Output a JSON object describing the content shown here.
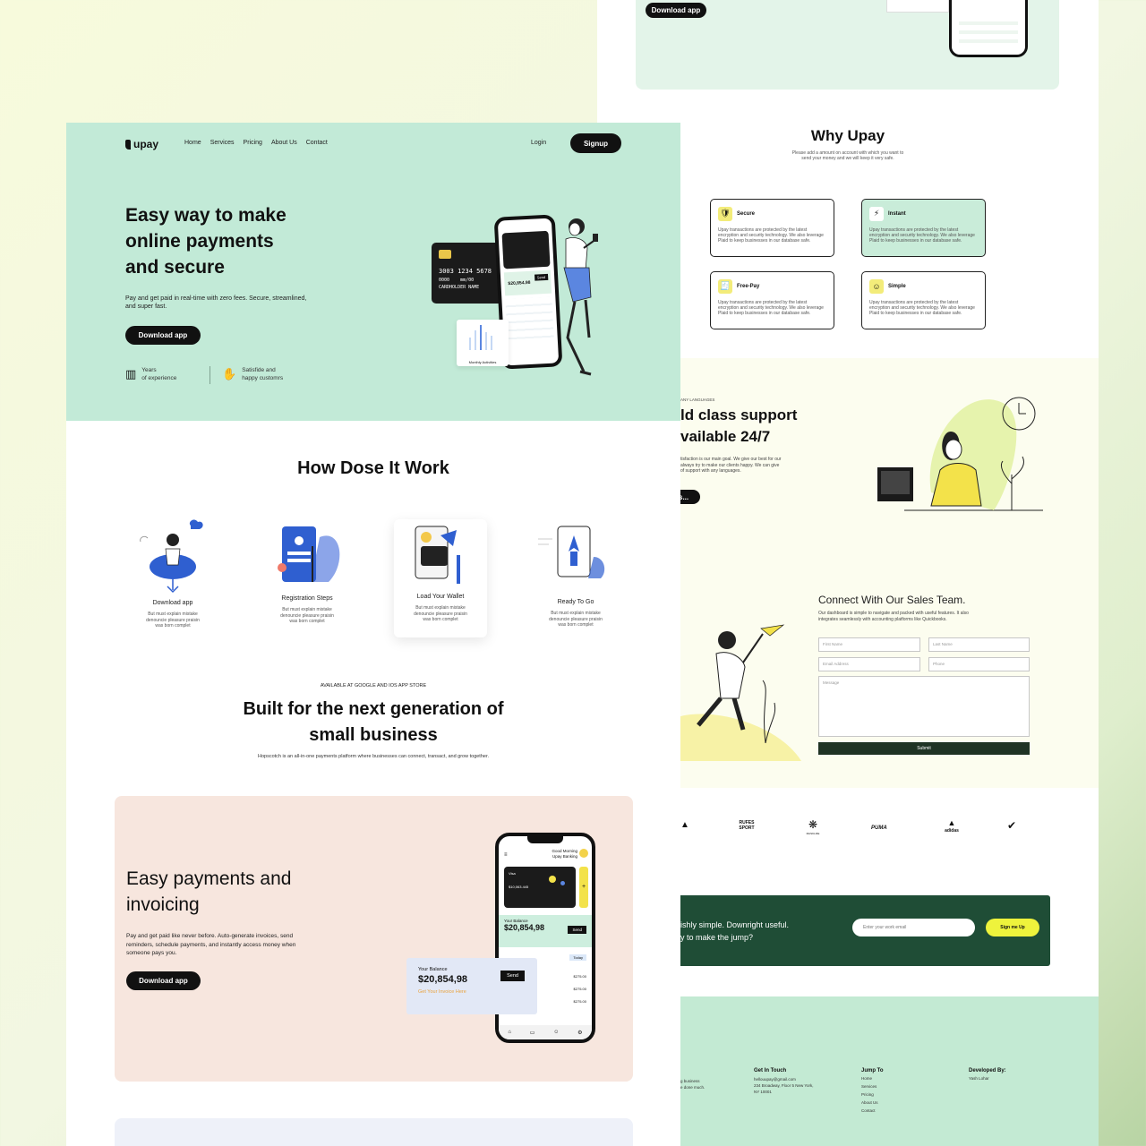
{
  "top_strip": {
    "download_label": "Download app"
  },
  "why": {
    "title": "Why Upay",
    "subtitle_line1": "Please add a amount on account with which you want to",
    "subtitle_line2": "send your money and we will keep it very safe.",
    "features": [
      {
        "icon": "shield-icon",
        "glyph": "🛡",
        "title": "Secure",
        "desc": "Upay transactions are protected by the latest encryption and security technology. We also leverage Plaid to keep businesses in our database safe."
      },
      {
        "icon": "lightning-icon",
        "glyph": "⚡",
        "title": "Instant",
        "desc": "Upay transactions are protected by the latest encryption and security technology. We also leverage Plaid to keep businesses in our database safe."
      },
      {
        "icon": "receipt-icon",
        "glyph": "🧾",
        "title": "Free-Pay",
        "desc": "Upay transactions are protected by the latest encryption and security technology. We also leverage Plaid to keep businesses in our database safe."
      },
      {
        "icon": "smile-icon",
        "glyph": "☺",
        "title": "Simple",
        "desc": "Upay transactions are protected by the latest encryption and security technology. We also leverage Plaid to keep businesses in our database safe."
      }
    ]
  },
  "support": {
    "eyebrow": "ANY LANGUAGES",
    "title_line1": "ld class support",
    "title_line2": "vailable 24/7",
    "desc_line1": "tisfaction is our main goal. We give our best for our",
    "desc_line2": "always try to make our clients happy. We can give",
    "desc_line3": "of support with any languages.",
    "button_label": "s..."
  },
  "contact": {
    "title": "Connect With Our Sales Team.",
    "desc_line1": "Our dashboard is simple to navigate and packed with useful features. It also",
    "desc_line2": "integrates seamlessly with accounting platforms like Quickbooks.",
    "first_name": "First Name",
    "last_name": "Last Name",
    "email": "Email Address",
    "phone": "Phone",
    "message": "Message",
    "submit_label": "Submit"
  },
  "brands": [
    {
      "name": "",
      "glyph": "▲"
    },
    {
      "name": "RUFES SPORT",
      "glyph": ""
    },
    {
      "name": "MASKLIFE",
      "glyph": "❋"
    },
    {
      "name": "PUMA",
      "glyph": ""
    },
    {
      "name": "adidas",
      "glyph": "▲"
    },
    {
      "name": "",
      "glyph": "✔"
    }
  ],
  "newsletter": {
    "line1": "ishly simple. Downright useful.",
    "line2": "y to make the jump?",
    "email_placeholder": "Enter your work email",
    "signup_label": "Sign me Up"
  },
  "footer": {
    "about_line1": "g business",
    "about_line2": "e done much.",
    "contact_title": "Get In Touch",
    "contact_email": "hellouupay@gmail.com",
    "contact_addr1": "234 Broadway, Floor 5 New York,",
    "contact_addr2": "NY 10001",
    "jump_title": "Jump To",
    "jump_links": [
      "Home",
      "Services",
      "Pricing",
      "About Us",
      "Contact"
    ],
    "dev_title": "Developed By:",
    "dev_name": "Yash Lohar"
  },
  "nav": {
    "logo": "upay",
    "links": [
      "Home",
      "Services",
      "Pricing",
      "About Us",
      "Contact"
    ],
    "login": "Login",
    "signup": "Signup"
  },
  "hero": {
    "title_line1": "Easy way to make",
    "title_line2": "online payments",
    "title_line3": "and secure",
    "desc_line1": "Pay and get paid in real-time with zero fees. Secure, streamlined,",
    "desc_line2": "and super fast.",
    "download_label": "Download app",
    "stat1_line1": "Years",
    "stat1_line2": "of experience",
    "stat2_line1": "Satisfide and",
    "stat2_line2": "happy customrs",
    "card_number": "3003 1234 5678",
    "card_sub1": "0000",
    "card_sub2": "mm/00",
    "card_holder": "CARDHOLDER NAME",
    "phone_balance": "$20,854.98",
    "phone_send": "Send",
    "chart_label": "Monthly Activities"
  },
  "how": {
    "title": "How Dose It Work",
    "steps": [
      {
        "title": "Download app",
        "desc1": "But must explain mistake",
        "desc2": "denouncie pleasure praisin",
        "desc3": "was born complet"
      },
      {
        "title": "Registration Steps",
        "desc1": "But must explain mistake",
        "desc2": "denouncie pleasure praisin",
        "desc3": "was born complet"
      },
      {
        "title": "Load Your Wallet",
        "desc1": "But must explain mistake",
        "desc2": "denouncie pleasure praisin",
        "desc3": "was born complet"
      },
      {
        "title": "Ready To Go",
        "desc1": "But must explain mistake",
        "desc2": "denouncie pleasure praisin",
        "desc3": "was born complet"
      }
    ]
  },
  "built": {
    "eyebrow": "AVAILABLE AT GOOGLE AND IOS APP STORE",
    "title_line1": "Built for the next generation of",
    "title_line2": "small business",
    "desc": "Hopscotch is an all-in-one payments platform where businesses can connect, transact, and grow together."
  },
  "invoice": {
    "title_line1": "Easy payments and",
    "title_line2": "invoicing",
    "desc_line1": "Pay and get paid like never before. Auto-generate invoices, send",
    "desc_line2": "reminders, schedule payments, and instantly access money when",
    "desc_line3": "someone pays you.",
    "download_label": "Download app",
    "phone_greeting": "Good Morning",
    "phone_bank": "Upay Banking",
    "card_brand": "Visa",
    "card_amount": "$10,063.445",
    "phone_balance_label": "Your Balance",
    "phone_balance": "$20,854,98",
    "phone_send": "Send",
    "popup_label": "Your Balance",
    "popup_balance": "$20,854,98",
    "popup_send": "Send",
    "popup_link": "Get Your Invoice Here",
    "txn_amount1": "$275.00",
    "txn_amount2": "$275.00",
    "txn_amount3": "$275.00",
    "today": "Today"
  }
}
